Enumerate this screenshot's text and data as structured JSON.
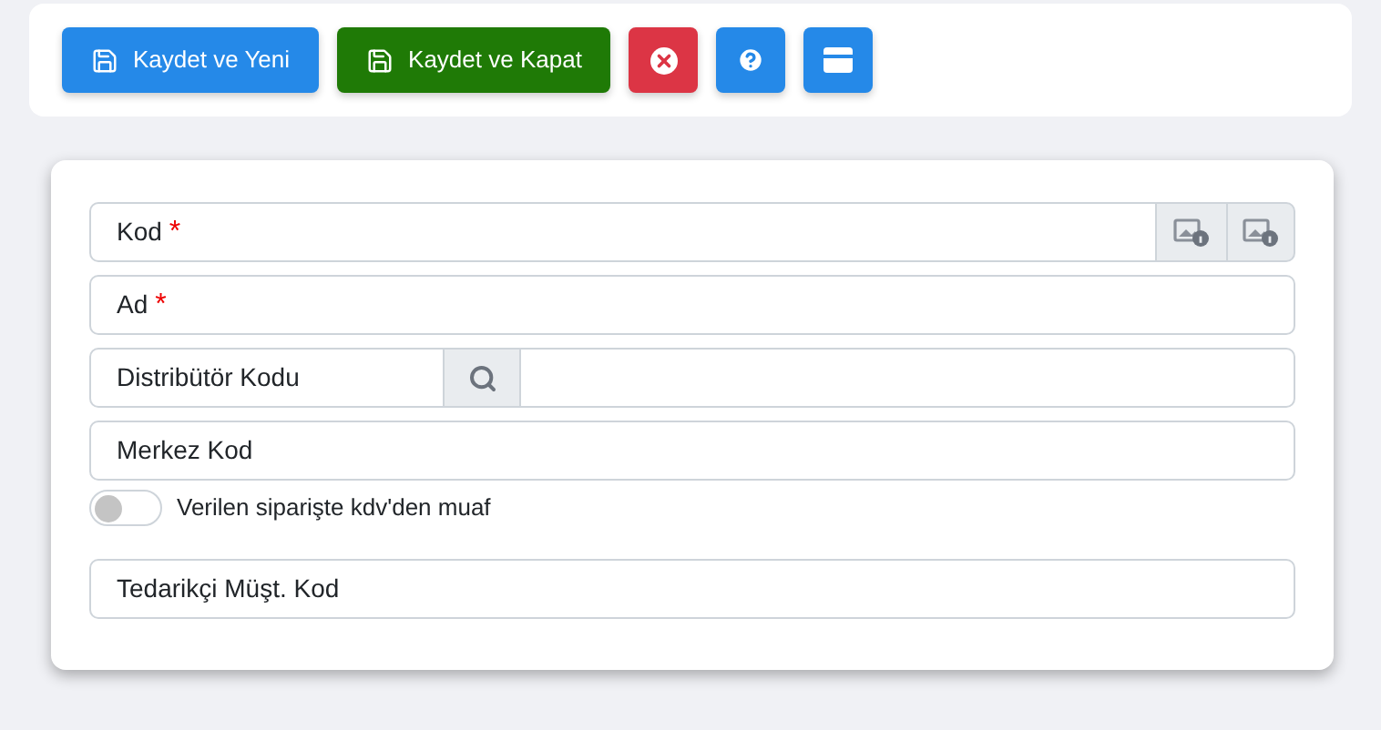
{
  "toolbar": [
    {
      "kind": "save",
      "label": "Kaydet ve Yeni",
      "color": "#2589e8"
    },
    {
      "kind": "save",
      "label": "Kaydet ve Kapat",
      "color": "#1f7a06"
    },
    {
      "kind": "close",
      "color": "#dc3545"
    },
    {
      "kind": "help",
      "color": "#2589e8"
    },
    {
      "kind": "window",
      "color": "#2589e8"
    }
  ],
  "fields": [
    {
      "kind": "addon-text",
      "label": "Kod",
      "required_mark": "*"
    },
    {
      "kind": "text",
      "label": "Ad",
      "required_mark": "*"
    },
    {
      "kind": "lookup",
      "label": "Distribütör Kodu"
    },
    {
      "kind": "text",
      "label": "Merkez Kod"
    },
    {
      "kind": "toggle",
      "label": "Verilen siparişte kdv'den muaf",
      "on": false
    },
    {
      "kind": "text",
      "label": "Tedarikçi Müşt. Kod"
    }
  ]
}
